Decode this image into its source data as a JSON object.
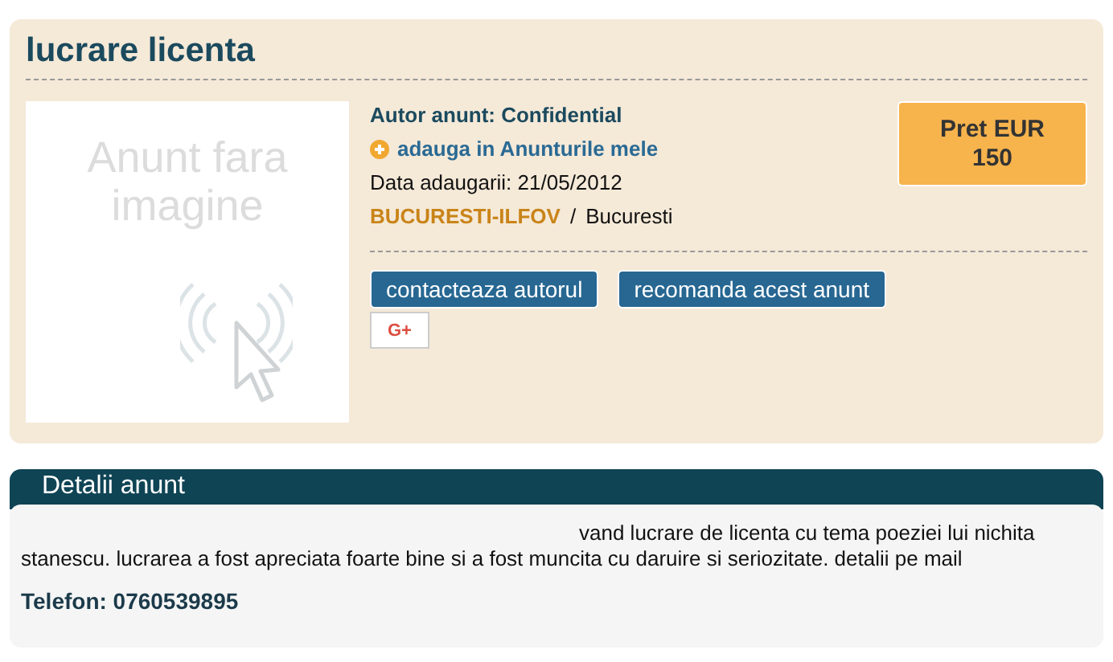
{
  "title": "lucrare licenta",
  "image_placeholder": {
    "line_1": "Anunt fara",
    "line_2": "imagine"
  },
  "author": "Autor anunt: Confidential",
  "add_favorites": "adauga in Anunturile mele",
  "date": "Data adaugarii: 21/05/2012",
  "region": "BUCURESTI-ILFOV",
  "separator": "/",
  "city": "Bucuresti",
  "price": {
    "label": "Pret EUR",
    "value": "150"
  },
  "buttons": [
    "contacteaza autorul",
    "recomanda acest anunt"
  ],
  "share": "G+",
  "details": {
    "heading": "Detalii anunt",
    "text": "vand lucrare de licenta cu tema poeziei lui nichita stanescu. lucrarea a fost apreciata foarte bine si a fost muncita cu daruire si seriozitate. detalii pe mail",
    "phone": "Telefon: 0760539895"
  }
}
